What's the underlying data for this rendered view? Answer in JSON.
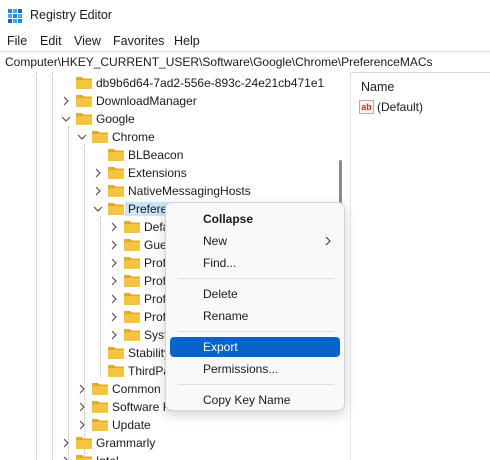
{
  "window": {
    "title": "Registry Editor",
    "icon": "registry-editor-icon"
  },
  "menubar": {
    "items": [
      {
        "label": "File"
      },
      {
        "label": "Edit"
      },
      {
        "label": "View"
      },
      {
        "label": "Favorites"
      },
      {
        "label": "Help"
      }
    ]
  },
  "address": {
    "path": "Computer\\HKEY_CURRENT_USER\\Software\\Google\\Chrome\\PreferenceMACs"
  },
  "tree": {
    "items": [
      {
        "label": "db9b6d64-7ad2-556e-893c-24e21cb471e1",
        "expanded": false,
        "has_children": false
      },
      {
        "label": "DownloadManager",
        "expanded": false,
        "has_children": true
      },
      {
        "label": "Google",
        "expanded": true,
        "has_children": true
      },
      {
        "label": "Chrome",
        "expanded": true,
        "has_children": true
      },
      {
        "label": "BLBeacon",
        "expanded": false,
        "has_children": false
      },
      {
        "label": "Extensions",
        "expanded": false,
        "has_children": true
      },
      {
        "label": "NativeMessagingHosts",
        "expanded": false,
        "has_children": true
      },
      {
        "label": "Preferen",
        "expanded": true,
        "has_children": true,
        "selected": true
      },
      {
        "label": "Defa",
        "expanded": false,
        "has_children": true
      },
      {
        "label": "Gues",
        "expanded": false,
        "has_children": true
      },
      {
        "label": "Profi",
        "expanded": false,
        "has_children": true
      },
      {
        "label": "Profi",
        "expanded": false,
        "has_children": true
      },
      {
        "label": "Profi",
        "expanded": false,
        "has_children": true
      },
      {
        "label": "Profi",
        "expanded": false,
        "has_children": true
      },
      {
        "label": "Syste",
        "expanded": false,
        "has_children": true
      },
      {
        "label": "Stability",
        "expanded": false,
        "has_children": false
      },
      {
        "label": "ThirdPa",
        "expanded": false,
        "has_children": false
      },
      {
        "label": "Common",
        "expanded": false,
        "has_children": true
      },
      {
        "label": "Software Re",
        "expanded": false,
        "has_children": true
      },
      {
        "label": "Update",
        "expanded": false,
        "has_children": true
      },
      {
        "label": "Grammarly",
        "expanded": false,
        "has_children": true
      },
      {
        "label": "Intel",
        "expanded": false,
        "has_children": true
      }
    ]
  },
  "values": {
    "column_header": "Name",
    "rows": [
      {
        "name": "(Default)",
        "icon": "string-value-icon",
        "icon_text": "ab"
      }
    ]
  },
  "context_menu": {
    "items": [
      {
        "label": "Collapse",
        "bold": true
      },
      {
        "label": "New",
        "submenu": true
      },
      {
        "label": "Find..."
      },
      {
        "label": "Delete"
      },
      {
        "label": "Rename"
      },
      {
        "label": "Export",
        "highlighted": true
      },
      {
        "label": "Permissions..."
      },
      {
        "label": "Copy Key Name"
      }
    ]
  },
  "colors": {
    "folder": "#f6c342",
    "folder_dark": "#e0a82e",
    "highlight": "#0a63c9",
    "selected": "#cce4f7"
  }
}
